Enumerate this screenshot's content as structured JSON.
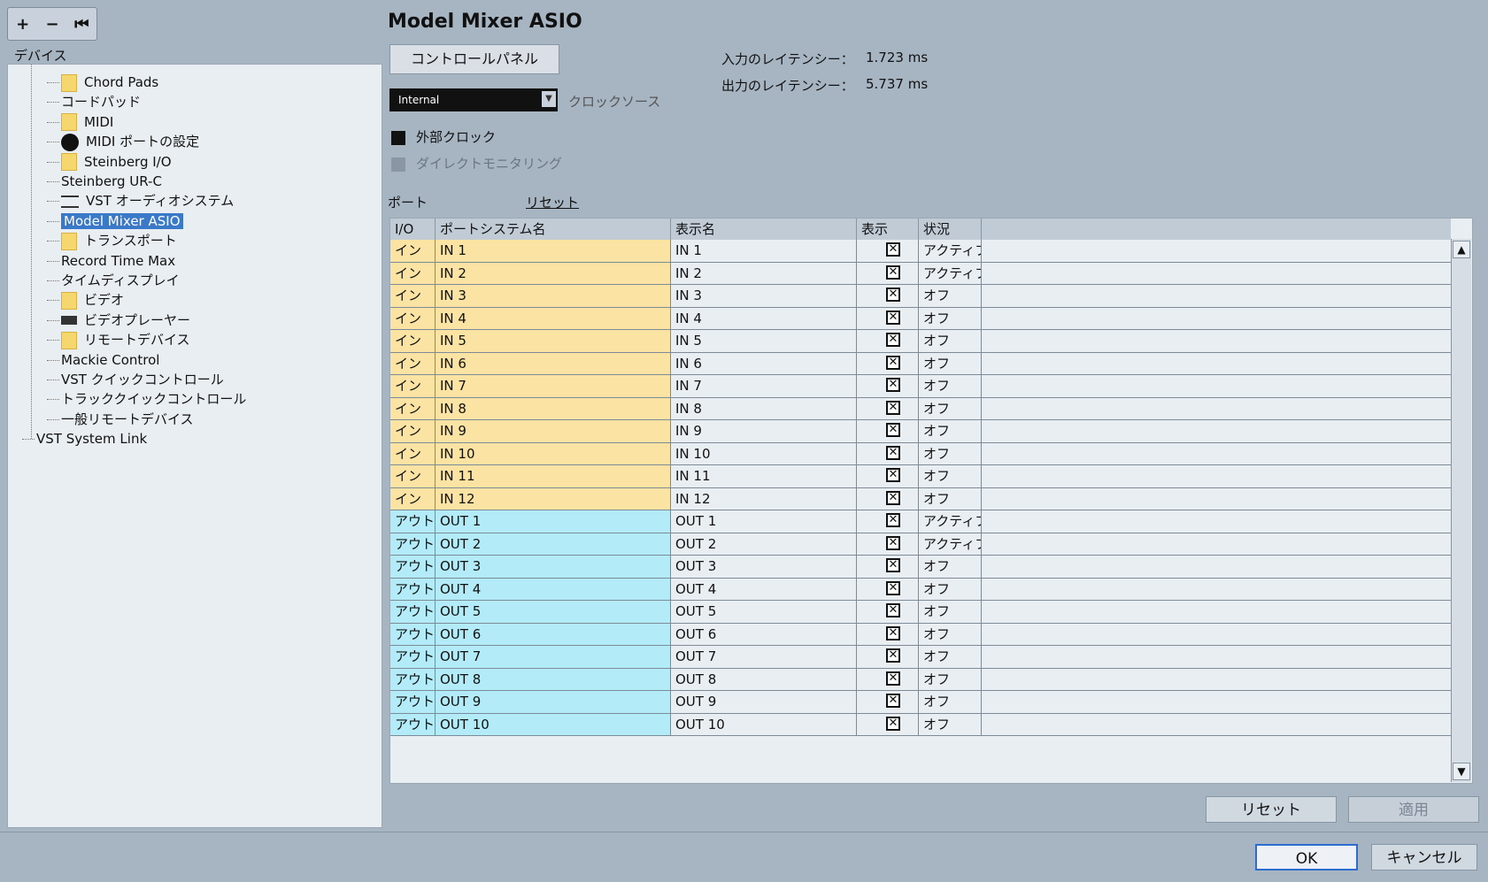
{
  "toolbar": {
    "add": "+",
    "remove": "−",
    "reset": "⏮"
  },
  "tree": {
    "header": "デバイス",
    "items": [
      {
        "label": "Chord Pads",
        "type": "folder"
      },
      {
        "label": "コードパッド",
        "type": "leaf"
      },
      {
        "label": "MIDI",
        "type": "folder"
      },
      {
        "label": "MIDI ポートの設定",
        "type": "midi"
      },
      {
        "label": "Steinberg I/O",
        "type": "folder"
      },
      {
        "label": "Steinberg UR-C",
        "type": "leaf"
      },
      {
        "label": "VST オーディオシステム",
        "type": "vst"
      },
      {
        "label": "Model Mixer ASIO",
        "type": "leaf-selected"
      },
      {
        "label": "トランスポート",
        "type": "folder"
      },
      {
        "label": "Record Time Max",
        "type": "leaf"
      },
      {
        "label": "タイムディスプレイ",
        "type": "leaf"
      },
      {
        "label": "ビデオ",
        "type": "folder"
      },
      {
        "label": "ビデオプレーヤー",
        "type": "video"
      },
      {
        "label": "リモートデバイス",
        "type": "folder"
      },
      {
        "label": "Mackie Control",
        "type": "leaf"
      },
      {
        "label": "VST クイックコントロール",
        "type": "leaf"
      },
      {
        "label": "トラッククイックコントロール",
        "type": "leaf"
      },
      {
        "label": "一般リモートデバイス",
        "type": "leaf"
      },
      {
        "label": "VST System Link",
        "type": "root-leaf"
      }
    ]
  },
  "device": {
    "title": "Model Mixer ASIO",
    "control_panel": "コントロールパネル",
    "latency_in_label": "入力のレイテンシー：",
    "latency_in_value": "1.723 ms",
    "latency_out_label": "出力のレイテンシー：",
    "latency_out_value": "5.737 ms",
    "clock_source_value": "Internal",
    "clock_source_label": "クロックソース",
    "external_clock": "外部クロック",
    "direct_monitoring": "ダイレクトモニタリング",
    "ports_label": "ポート",
    "reset_link": "リセット"
  },
  "table": {
    "headers": {
      "io": "I/O",
      "system_name": "ポートシステム名",
      "display_name": "表示名",
      "show": "表示",
      "status": "状況"
    },
    "rows": [
      {
        "io": "イン",
        "system_name": "IN 1",
        "display_name": "IN 1",
        "show": "✕",
        "status": "アクティブ",
        "kind": "in"
      },
      {
        "io": "イン",
        "system_name": "IN 2",
        "display_name": "IN 2",
        "show": "✕",
        "status": "アクティブ",
        "kind": "in"
      },
      {
        "io": "イン",
        "system_name": "IN 3",
        "display_name": "IN 3",
        "show": "✕",
        "status": "オフ",
        "kind": "in"
      },
      {
        "io": "イン",
        "system_name": "IN 4",
        "display_name": "IN 4",
        "show": "✕",
        "status": "オフ",
        "kind": "in"
      },
      {
        "io": "イン",
        "system_name": "IN 5",
        "display_name": "IN 5",
        "show": "✕",
        "status": "オフ",
        "kind": "in"
      },
      {
        "io": "イン",
        "system_name": "IN 6",
        "display_name": "IN 6",
        "show": "✕",
        "status": "オフ",
        "kind": "in"
      },
      {
        "io": "イン",
        "system_name": "IN 7",
        "display_name": "IN 7",
        "show": "✕",
        "status": "オフ",
        "kind": "in"
      },
      {
        "io": "イン",
        "system_name": "IN 8",
        "display_name": "IN 8",
        "show": "✕",
        "status": "オフ",
        "kind": "in"
      },
      {
        "io": "イン",
        "system_name": "IN 9",
        "display_name": "IN 9",
        "show": "✕",
        "status": "オフ",
        "kind": "in"
      },
      {
        "io": "イン",
        "system_name": "IN 10",
        "display_name": "IN 10",
        "show": "✕",
        "status": "オフ",
        "kind": "in"
      },
      {
        "io": "イン",
        "system_name": "IN 11",
        "display_name": "IN 11",
        "show": "✕",
        "status": "オフ",
        "kind": "in"
      },
      {
        "io": "イン",
        "system_name": "IN 12",
        "display_name": "IN 12",
        "show": "✕",
        "status": "オフ",
        "kind": "in"
      },
      {
        "io": "アウト",
        "system_name": "OUT 1",
        "display_name": "OUT 1",
        "show": "✕",
        "status": "アクティブ",
        "kind": "out"
      },
      {
        "io": "アウト",
        "system_name": "OUT 2",
        "display_name": "OUT 2",
        "show": "✕",
        "status": "アクティブ",
        "kind": "out"
      },
      {
        "io": "アウト",
        "system_name": "OUT 3",
        "display_name": "OUT 3",
        "show": "✕",
        "status": "オフ",
        "kind": "out"
      },
      {
        "io": "アウト",
        "system_name": "OUT 4",
        "display_name": "OUT 4",
        "show": "✕",
        "status": "オフ",
        "kind": "out"
      },
      {
        "io": "アウト",
        "system_name": "OUT 5",
        "display_name": "OUT 5",
        "show": "✕",
        "status": "オフ",
        "kind": "out"
      },
      {
        "io": "アウト",
        "system_name": "OUT 6",
        "display_name": "OUT 6",
        "show": "✕",
        "status": "オフ",
        "kind": "out"
      },
      {
        "io": "アウト",
        "system_name": "OUT 7",
        "display_name": "OUT 7",
        "show": "✕",
        "status": "オフ",
        "kind": "out"
      },
      {
        "io": "アウト",
        "system_name": "OUT 8",
        "display_name": "OUT 8",
        "show": "✕",
        "status": "オフ",
        "kind": "out"
      },
      {
        "io": "アウト",
        "system_name": "OUT 9",
        "display_name": "OUT 9",
        "show": "✕",
        "status": "オフ",
        "kind": "out"
      },
      {
        "io": "アウト",
        "system_name": "OUT 10",
        "display_name": "OUT 10",
        "show": "✕",
        "status": "オフ",
        "kind": "out"
      }
    ]
  },
  "buttons": {
    "reset": "リセット",
    "apply": "適用",
    "ok": "OK",
    "cancel": "キャンセル"
  },
  "scroll": {
    "up": "▲",
    "down": "▼"
  }
}
